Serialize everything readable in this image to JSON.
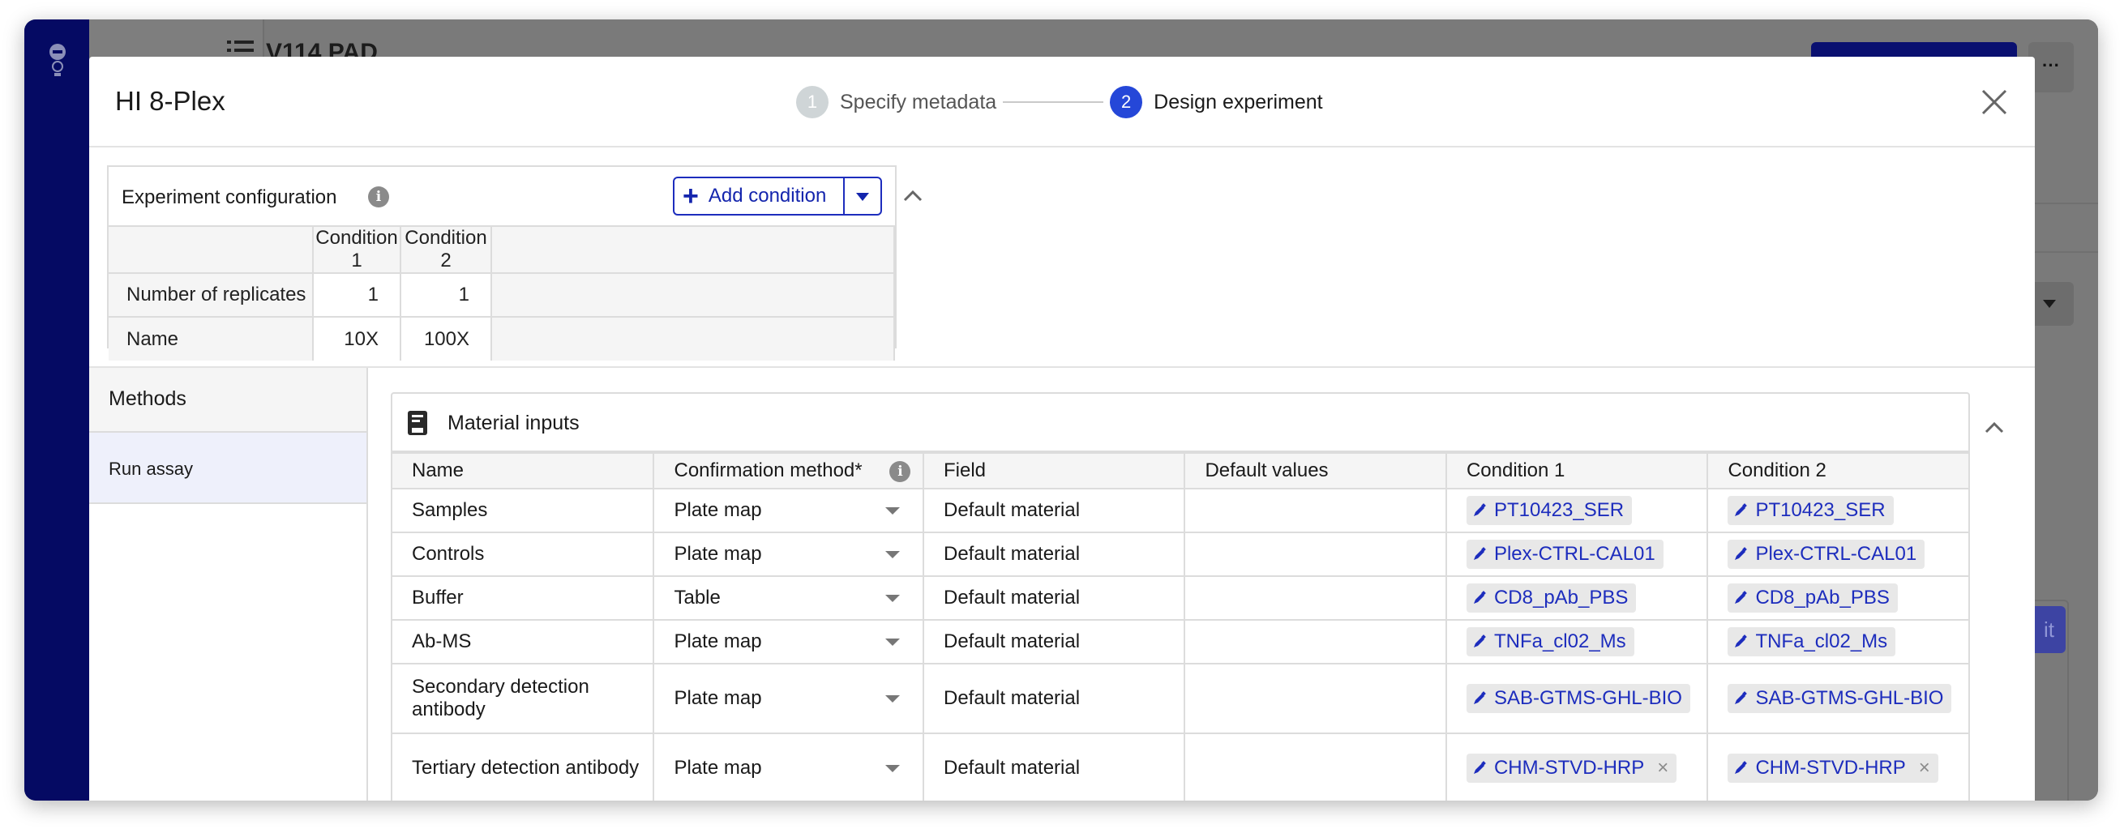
{
  "background_app": {
    "page_title": "V114 PAD",
    "more_label": "···",
    "edit_label": "it"
  },
  "modal": {
    "title": "HI 8-Plex",
    "steps": [
      {
        "number": "1",
        "label": "Specify metadata",
        "state": "done"
      },
      {
        "number": "2",
        "label": "Design experiment",
        "state": "active"
      }
    ],
    "close_icon": "close-icon"
  },
  "experiment_config": {
    "title": "Experiment configuration",
    "info_label": "i",
    "add_condition_label": "Add condition",
    "columns": [
      "",
      "Condition 1",
      "Condition 2",
      ""
    ],
    "rows": [
      {
        "label": "Number of replicates",
        "values": [
          "1",
          "1"
        ]
      },
      {
        "label": "Name",
        "values": [
          "10X",
          "100X"
        ]
      }
    ]
  },
  "methods": {
    "header": "Methods",
    "items": [
      "Run assay"
    ]
  },
  "material_inputs": {
    "title": "Material inputs",
    "info_label": "i",
    "columns": [
      "Name",
      "Confirmation method*",
      "Field",
      "Default values",
      "Condition 1",
      "Condition 2"
    ],
    "rows": [
      {
        "name": "Samples",
        "method": "Plate map",
        "field": "Default material",
        "default": "",
        "c1": "PT10423_SER",
        "c2": "PT10423_SER",
        "removable": false
      },
      {
        "name": "Controls",
        "method": "Plate map",
        "field": "Default material",
        "default": "",
        "c1": "Plex-CTRL-CAL01",
        "c2": "Plex-CTRL-CAL01",
        "removable": false
      },
      {
        "name": "Buffer",
        "method": "Table",
        "field": "Default material",
        "default": "",
        "c1": "CD8_pAb_PBS",
        "c2": "CD8_pAb_PBS",
        "removable": false
      },
      {
        "name": "Ab-MS",
        "method": "Plate map",
        "field": "Default material",
        "default": "",
        "c1": "TNFa_cl02_Ms",
        "c2": "TNFa_cl02_Ms",
        "removable": false
      },
      {
        "name": "Secondary detection antibody",
        "method": "Plate map",
        "field": "Default material",
        "default": "",
        "c1": "SAB-GTMS-GHL-BIO",
        "c2": "SAB-GTMS-GHL-BIO",
        "removable": false
      },
      {
        "name": "Tertiary detection antibody",
        "method": "Plate map",
        "field": "Default material",
        "default": "",
        "c1": "CHM-STVD-HRP",
        "c2": "CHM-STVD-HRP",
        "removable": true
      }
    ],
    "remove_label": "×"
  },
  "colors": {
    "accent": "#1d2dbd",
    "step_active": "#2547d8",
    "sidebar": "#050a63"
  }
}
